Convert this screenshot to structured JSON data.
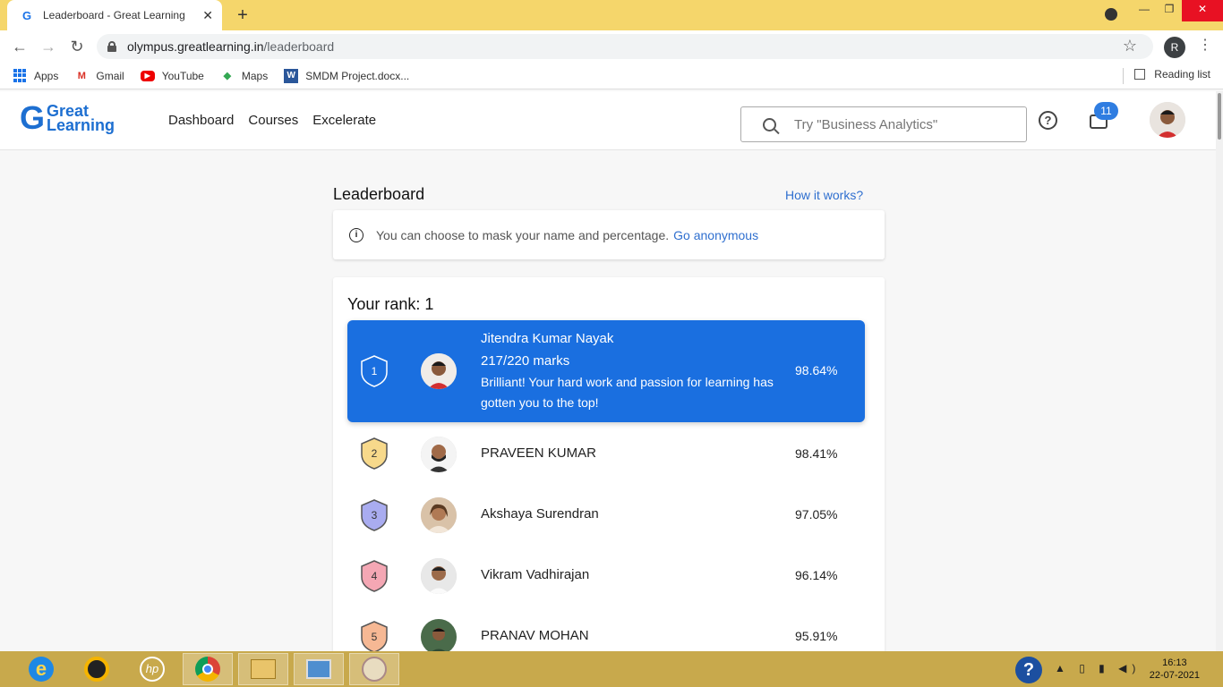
{
  "browser": {
    "tab_title": "Leaderboard - Great Learning",
    "tab_close": "✕",
    "new_tab": "+",
    "url_host": "olympus.greatlearning.in",
    "url_path": "/leaderboard",
    "profile_initial": "R",
    "bookmarks": [
      "Apps",
      "Gmail",
      "YouTube",
      "Maps",
      "SMDM Project.docx..."
    ],
    "reading_list": "Reading list"
  },
  "header": {
    "logo_top": "Great",
    "logo_bottom": "Learning",
    "nav": [
      "Dashboard",
      "Courses",
      "Excelerate"
    ],
    "search_placeholder": "Try \"Business Analytics\"",
    "help_glyph": "?",
    "notification_count": "11"
  },
  "leaderboard": {
    "title": "Leaderboard",
    "how_it_works": "How it works?",
    "notice_text": "You can choose to mask your name and percentage.",
    "notice_link": "Go anonymous",
    "your_rank": "Your rank: 1",
    "me": {
      "rank": "1",
      "name": "Jitendra Kumar Nayak",
      "marks": "217/220 marks",
      "message": "Brilliant! Your hard work and passion for learning has gotten you to the top!",
      "percent": "98.64%"
    },
    "rows": [
      {
        "rank": "2",
        "name": "PRAVEEN KUMAR",
        "percent": "98.41%",
        "shield_color": "#f7d98b"
      },
      {
        "rank": "3",
        "name": "Akshaya Surendran",
        "percent": "97.05%",
        "shield_color": "#a9acf0"
      },
      {
        "rank": "4",
        "name": "Vikram Vadhirajan",
        "percent": "96.14%",
        "shield_color": "#f4a7b4"
      },
      {
        "rank": "5",
        "name": "PRANAV MOHAN",
        "percent": "95.91%",
        "shield_color": "#f6b894"
      }
    ]
  },
  "taskbar": {
    "time": "16:13",
    "date": "22-07-2021",
    "help_glyph": "?"
  },
  "colors": {
    "accent": "#1a6fe0",
    "tabbar": "#f5d66b",
    "taskbar": "#c8a94c"
  }
}
